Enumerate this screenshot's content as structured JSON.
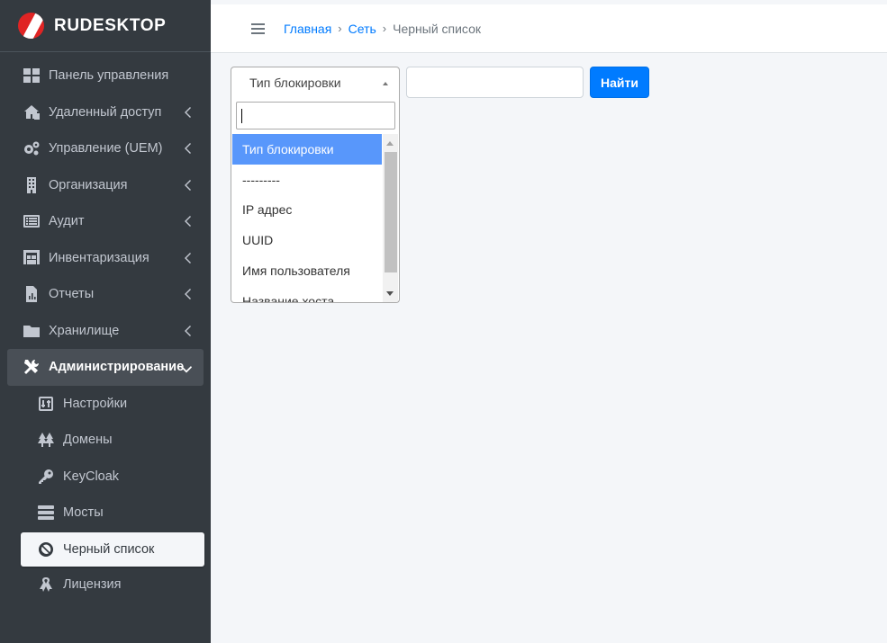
{
  "brand": {
    "name": "RUDESKTOP"
  },
  "sidebar": {
    "items": [
      {
        "label": "Панель управления",
        "icon": "dashboard-icon"
      },
      {
        "label": "Удаленный доступ",
        "icon": "remote-access-icon"
      },
      {
        "label": "Управление (UEM)",
        "icon": "gears-icon"
      },
      {
        "label": "Организация",
        "icon": "building-icon"
      },
      {
        "label": "Аудит",
        "icon": "list-icon"
      },
      {
        "label": "Инвентаризация",
        "icon": "warehouse-icon"
      },
      {
        "label": "Отчеты",
        "icon": "report-icon"
      },
      {
        "label": "Хранилище",
        "icon": "folder-icon"
      },
      {
        "label": "Администрирование",
        "icon": "tools-icon"
      }
    ],
    "subitems": [
      {
        "label": "Настройки",
        "icon": "settings-icon"
      },
      {
        "label": "Домены",
        "icon": "trees-icon"
      },
      {
        "label": "KeyCloak",
        "icon": "key-icon"
      },
      {
        "label": "Мосты",
        "icon": "server-icon"
      },
      {
        "label": "Черный список",
        "icon": "ban-icon"
      },
      {
        "label": "Лицензия",
        "icon": "ribbon-icon"
      }
    ]
  },
  "breadcrumb": {
    "home": "Главная",
    "network": "Сеть",
    "current": "Черный список",
    "separator": "›"
  },
  "filter": {
    "select_value": "Тип блокировки",
    "search_value": "",
    "find_label": "Найти"
  },
  "dropdown": {
    "search_value": "",
    "options": [
      "Тип блокировки",
      "---------",
      "IP адрес",
      "UUID",
      "Имя пользователя",
      "Название хоста"
    ]
  },
  "colors": {
    "sidebar": "#343a40",
    "primary": "#007bff",
    "highlight": "#5897fb",
    "logo": "#e02424"
  }
}
